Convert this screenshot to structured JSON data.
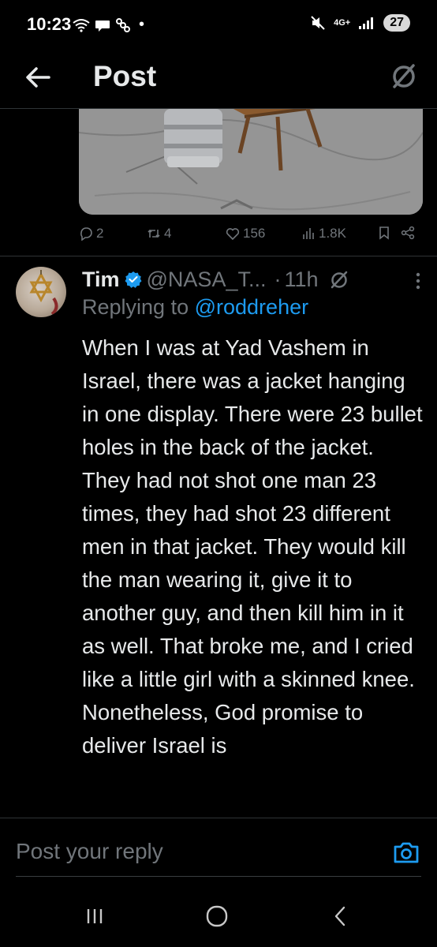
{
  "status_bar": {
    "time": "10:23",
    "dot": "•",
    "network": "4G+",
    "battery": "27"
  },
  "header": {
    "title": "Post"
  },
  "parent_post_actions": {
    "replies": "2",
    "reposts": "4",
    "likes": "156",
    "views": "1.8K"
  },
  "reply": {
    "name": "Tim",
    "handle": "@NASA_T...",
    "dot": "·",
    "time": "11h",
    "replying_prefix": "Replying to",
    "replying_to": "@roddreher",
    "text": "When I was at Yad Vashem in Israel, there was a jacket hanging in one display. There were 23 bullet holes in the back of the jacket. They had not shot one man 23 times, they had shot 23 different men in that jacket. They would kill the man wearing it, give it to another guy, and then kill him in it as well. That broke me, and I cried like a little girl with a skinned knee.  Nonetheless, God promise to deliver Israel is"
  },
  "composer": {
    "placeholder": "Post your reply"
  },
  "colors": {
    "accent": "#1d9bf0",
    "muted": "#71767b",
    "text": "#e7e9ea",
    "background": "#000000"
  }
}
